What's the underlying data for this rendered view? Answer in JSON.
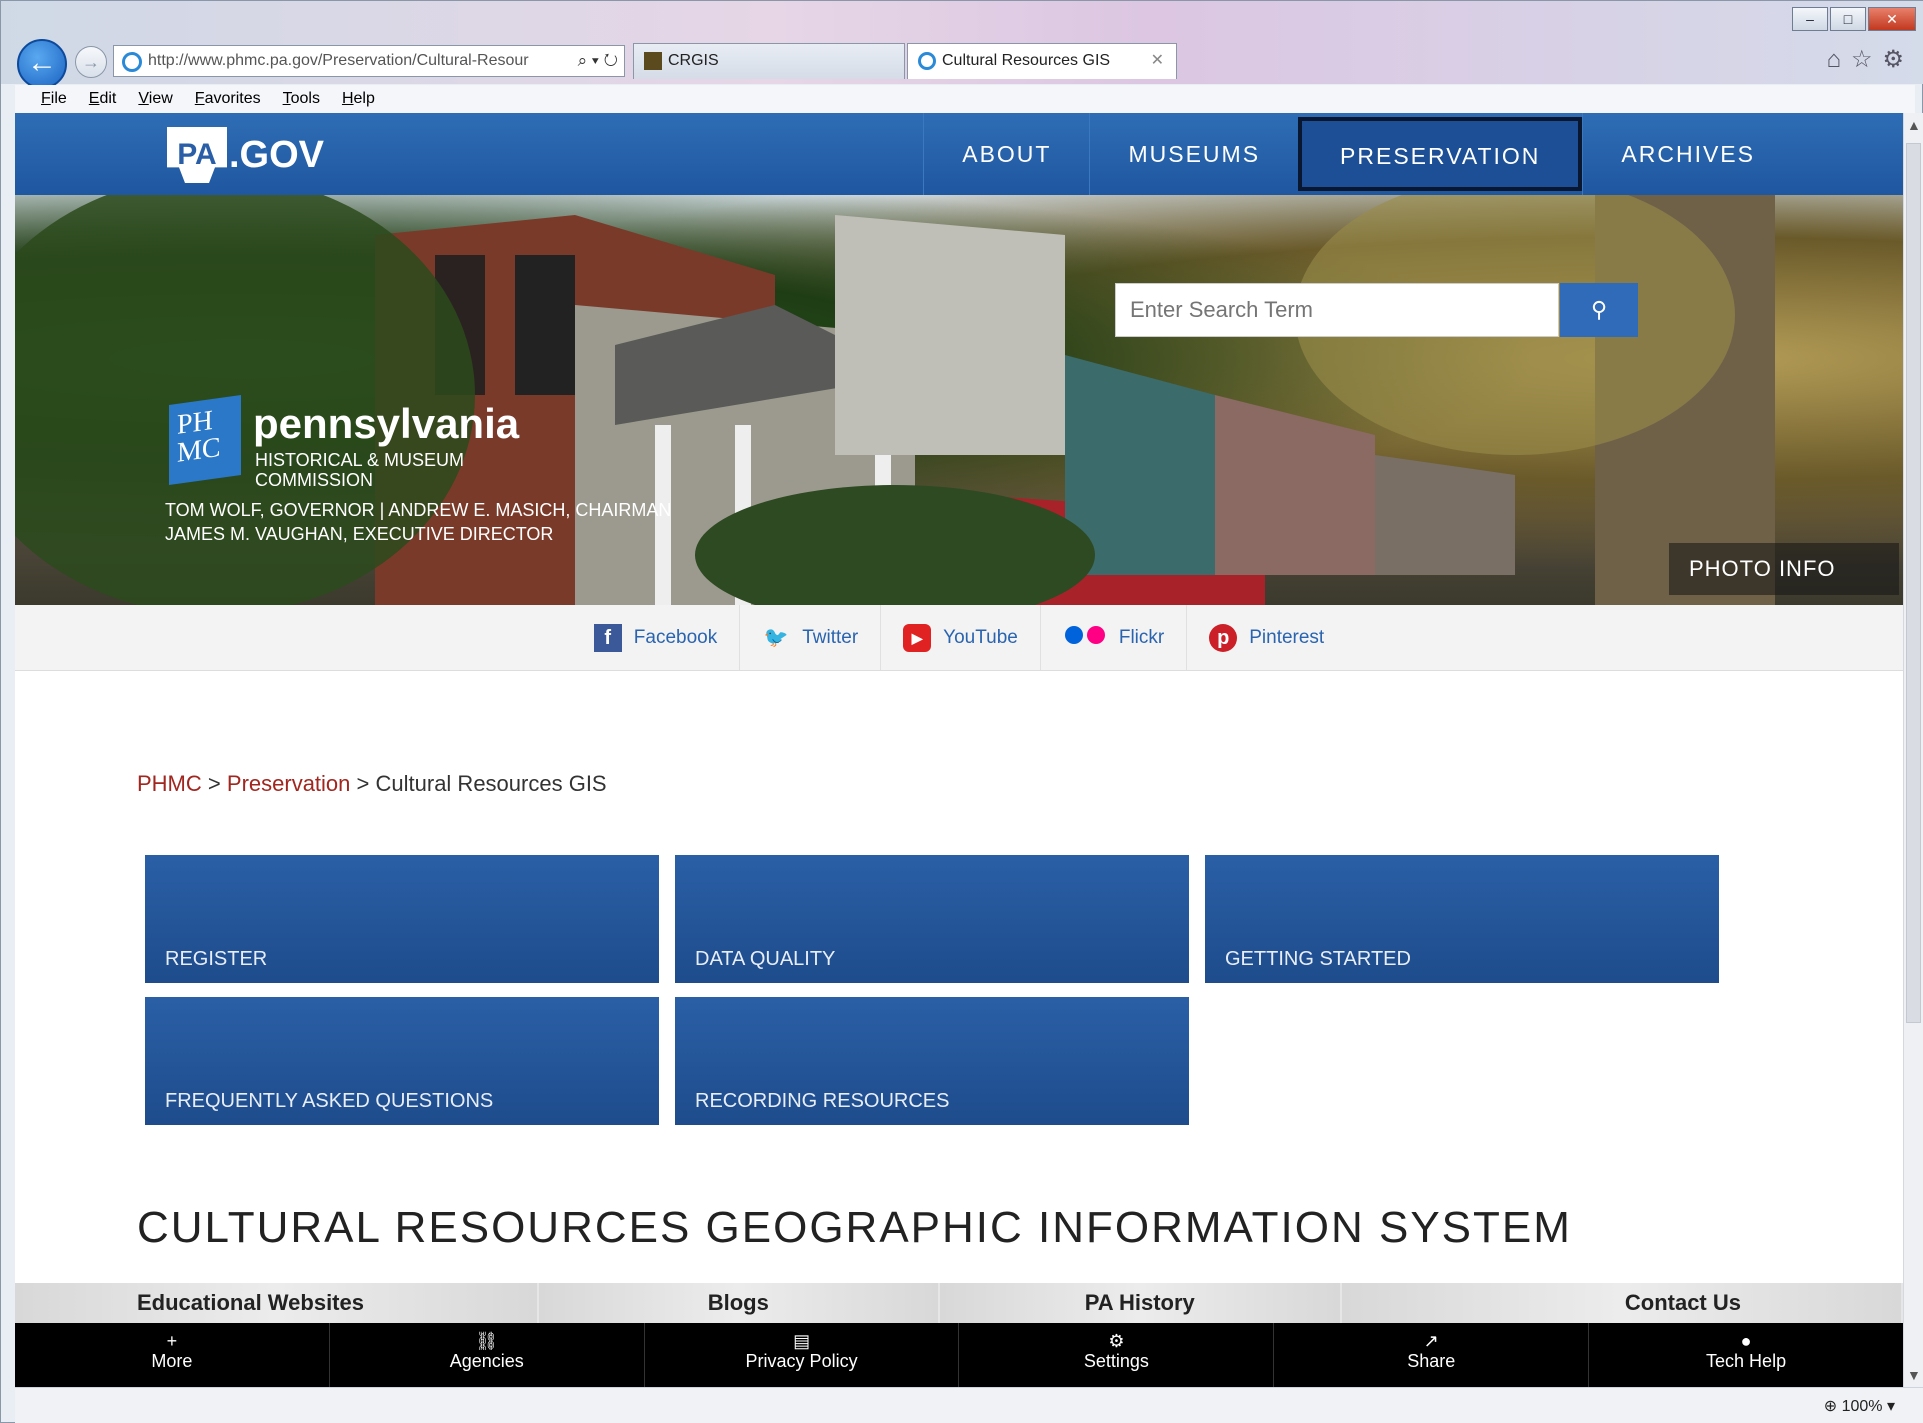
{
  "browser": {
    "address": "http://www.phmc.pa.gov/Preservation/Cultural-Resour",
    "tabs": [
      {
        "label": "CRGIS"
      },
      {
        "label": "Cultural Resources GIS"
      }
    ],
    "menu": [
      "File",
      "Edit",
      "View",
      "Favorites",
      "Tools",
      "Help"
    ],
    "zoom": "100%"
  },
  "site": {
    "logo": "PA.GOV",
    "logo_key": "PA",
    "logo_rest": ".GOV",
    "nav": [
      {
        "label": "ABOUT"
      },
      {
        "label": "MUSEUMS"
      },
      {
        "label": "PRESERVATION"
      },
      {
        "label": "ARCHIVES"
      }
    ],
    "search_placeholder": "Enter Search Term",
    "org_name": "pennsylvania",
    "org_sub1": "HISTORICAL & MUSEUM",
    "org_sub2": "COMMISSION",
    "badge": "PH MC",
    "officials1": "TOM WOLF, GOVERNOR   |   ANDREW E. MASICH, CHAIRMAN",
    "officials2": "JAMES M. VAUGHAN, EXECUTIVE DIRECTOR",
    "photo_info": "PHOTO INFO"
  },
  "social": [
    {
      "label": "Facebook",
      "icon": "facebook-icon",
      "color": "#3b5998"
    },
    {
      "label": "Twitter",
      "icon": "twitter-icon",
      "color": "#1da1f2"
    },
    {
      "label": "YouTube",
      "icon": "youtube-icon",
      "color": "#e02222"
    },
    {
      "label": "Flickr",
      "icon": "flickr-icon",
      "color": "#0063dc"
    },
    {
      "label": "Pinterest",
      "icon": "pinterest-icon",
      "color": "#cb2027"
    }
  ],
  "breadcrumb": {
    "phmc": "PHMC",
    "preservation": "Preservation",
    "current": "Cultural Resources GIS",
    "sep": ">"
  },
  "tiles": [
    "REGISTER",
    "DATA QUALITY",
    "GETTING STARTED",
    "FREQUENTLY ASKED QUESTIONS",
    "RECORDING RESOURCES"
  ],
  "page_title": "CULTURAL RESOURCES GEOGRAPHIC INFORMATION SYSTEM",
  "footer_links": [
    "Educational Websites",
    "Blogs",
    "PA History",
    "Contact Us"
  ],
  "footer_bar": [
    {
      "label": "More",
      "icon": "+"
    },
    {
      "label": "Agencies",
      "icon": "⛓"
    },
    {
      "label": "Privacy Policy",
      "icon": "▤"
    },
    {
      "label": "Settings",
      "icon": "⚙"
    },
    {
      "label": "Share",
      "icon": "↗"
    },
    {
      "label": "Tech Help",
      "icon": "●"
    }
  ]
}
